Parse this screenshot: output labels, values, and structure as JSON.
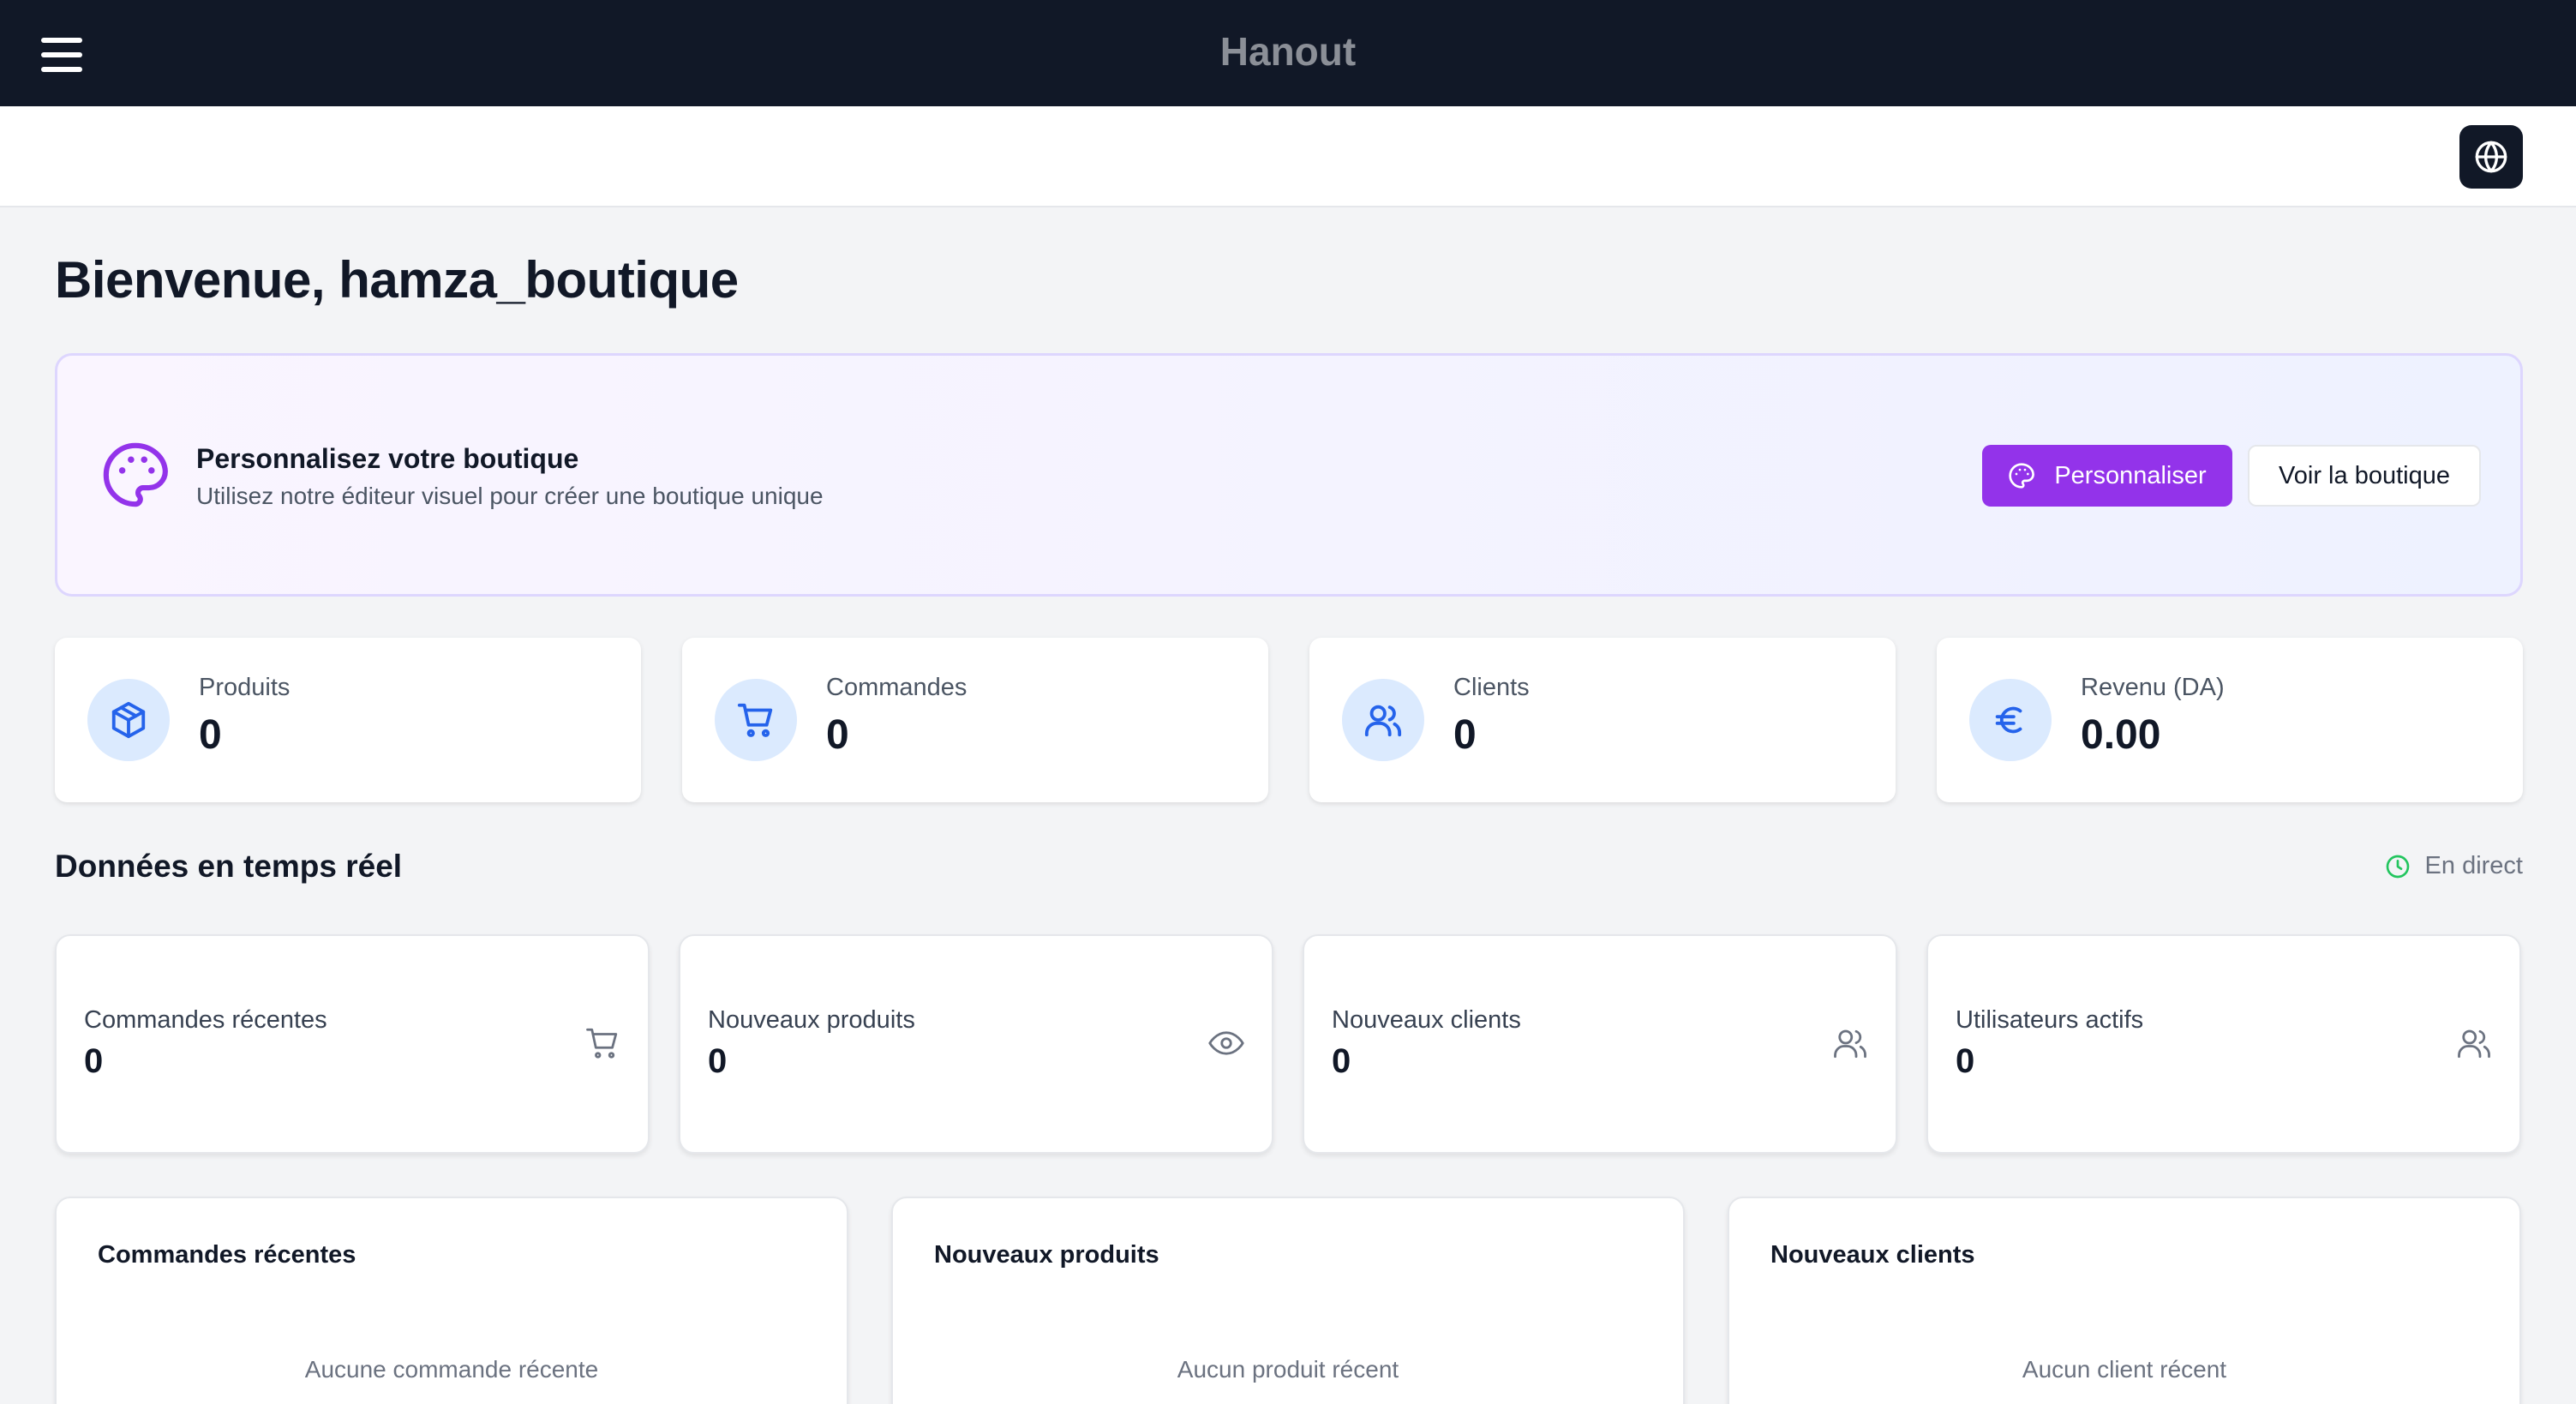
{
  "app": {
    "title": "Hanout"
  },
  "header": {
    "menu_icon": "hamburger-menu-icon",
    "language_icon": "globe-icon"
  },
  "welcome": {
    "title": "Bienvenue, hamza_boutique"
  },
  "promo": {
    "icon": "palette-icon",
    "title": "Personnalisez votre boutique",
    "subtitle": "Utilisez notre éditeur visuel pour créer une boutique unique",
    "customize_label": "Personnaliser",
    "view_label": "Voir la boutique",
    "accent": "#9333ea"
  },
  "stats": [
    {
      "label": "Produits",
      "value": "0",
      "icon": "package-icon"
    },
    {
      "label": "Commandes",
      "value": "0",
      "icon": "shopping-cart-icon"
    },
    {
      "label": "Clients",
      "value": "0",
      "icon": "users-icon"
    },
    {
      "label": "Revenu (DA)",
      "value": "0.00",
      "icon": "euro-icon"
    }
  ],
  "realtime": {
    "title": "Données en temps réel",
    "live_label": "En direct",
    "live_color": "#22c55e",
    "cards": [
      {
        "label": "Commandes récentes",
        "value": "0",
        "icon": "shopping-cart-icon"
      },
      {
        "label": "Nouveaux produits",
        "value": "0",
        "icon": "eye-icon"
      },
      {
        "label": "Nouveaux clients",
        "value": "0",
        "icon": "users-icon"
      },
      {
        "label": "Utilisateurs actifs",
        "value": "0",
        "icon": "users-icon"
      }
    ]
  },
  "lists": [
    {
      "title": "Commandes récentes",
      "empty": "Aucune commande récente"
    },
    {
      "title": "Nouveaux produits",
      "empty": "Aucun produit récent"
    },
    {
      "title": "Nouveaux clients",
      "empty": "Aucun client récent"
    }
  ]
}
